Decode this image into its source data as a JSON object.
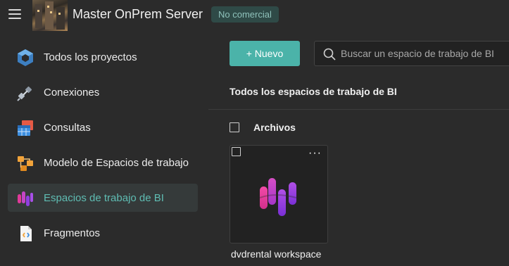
{
  "header": {
    "server_name": "Master OnPrem Server",
    "license_badge": "No comercial"
  },
  "sidebar": {
    "items": [
      {
        "label": "Todos los proyectos",
        "icon": "projects-cube-icon",
        "active": false
      },
      {
        "label": "Conexiones",
        "icon": "plug-connection-icon",
        "active": false
      },
      {
        "label": "Consultas",
        "icon": "query-table-icon",
        "active": false
      },
      {
        "label": "Modelo de Espacios de trabajo",
        "icon": "workspace-model-icon",
        "active": false
      },
      {
        "label": "Espacios de trabajo de BI",
        "icon": "bi-workspace-icon",
        "active": true
      },
      {
        "label": "Fragmentos",
        "icon": "fragments-icon",
        "active": false
      }
    ]
  },
  "toolbar": {
    "new_button_label": "+ Nuevo",
    "search_placeholder": "Buscar un espacio de trabajo de BI"
  },
  "main": {
    "section_title": "Todos los espacios de trabajo de BI",
    "group_label": "Archivos",
    "workspaces": [
      {
        "name": "dvdrental workspace",
        "more_label": "···"
      }
    ]
  },
  "colors": {
    "accent": "#4bb3a9",
    "active_text": "#5fbdb3",
    "badge_bg": "#2f4a47",
    "background": "#2b2b2b"
  }
}
